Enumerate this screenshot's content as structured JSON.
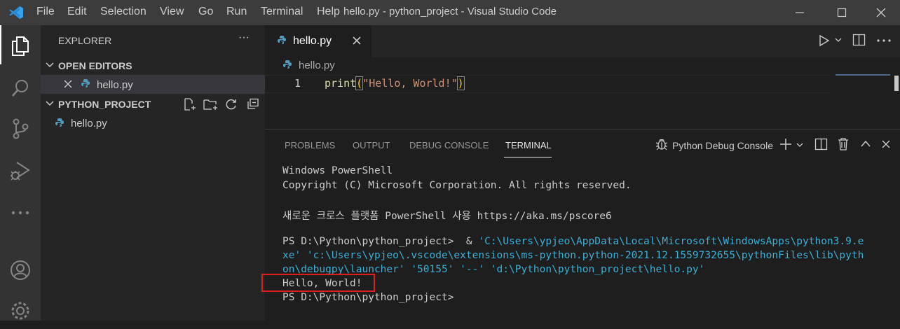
{
  "title_bar": {
    "menus": [
      "File",
      "Edit",
      "Selection",
      "View",
      "Go",
      "Run",
      "Terminal",
      "Help"
    ],
    "window_title": "hello.py - python_project - Visual Studio Code"
  },
  "activity_bar": {
    "icons": [
      "explorer-icon",
      "search-icon",
      "source-control-icon",
      "run-debug-icon",
      "more-icon",
      "account-icon",
      "settings-gear-icon"
    ]
  },
  "sidebar": {
    "header": "EXPLORER",
    "more": "···",
    "open_editors": {
      "title": "OPEN EDITORS",
      "items": [
        {
          "name": "hello.py"
        }
      ]
    },
    "project": {
      "title": "PYTHON_PROJECT",
      "files": [
        {
          "name": "hello.py"
        }
      ]
    }
  },
  "editor": {
    "tab_label": "hello.py",
    "breadcrumb": "hello.py",
    "line_number": "1",
    "code": {
      "func": "print",
      "open": "(",
      "string": "\"Hello, World!\"",
      "close": ")"
    }
  },
  "panel": {
    "tabs": [
      "PROBLEMS",
      "OUTPUT",
      "DEBUG CONSOLE",
      "TERMINAL"
    ],
    "active_tab": "TERMINAL",
    "terminal_selector": "Python Debug Console",
    "terminal_lines": {
      "l1": "Windows PowerShell",
      "l2": "Copyright (C) Microsoft Corporation. All rights reserved.",
      "l3": "새로운 크로스 플랫폼 PowerShell 사용 https://aka.ms/pscore6",
      "l4_prompt": "PS D:\\Python\\python_project>  & ",
      "l4_cmd": "'C:\\Users\\ypjeo\\AppData\\Local\\Microsoft\\WindowsApps\\python3.9.e",
      "l5": "xe' 'c:\\Users\\ypjeo\\.vscode\\extensions\\ms-python.python-2021.12.1559732655\\pythonFiles\\lib\\pyth",
      "l6": "on\\debugpy\\launcher' '50155' '--' 'd:\\Python\\python_project\\hello.py'",
      "l7": "Hello, World!",
      "l8": "PS D:\\Python\\python_project>"
    }
  },
  "colors": {
    "accent": "#007acc",
    "highlight_box": "#e01e1e",
    "python_icon": "#519aba"
  }
}
